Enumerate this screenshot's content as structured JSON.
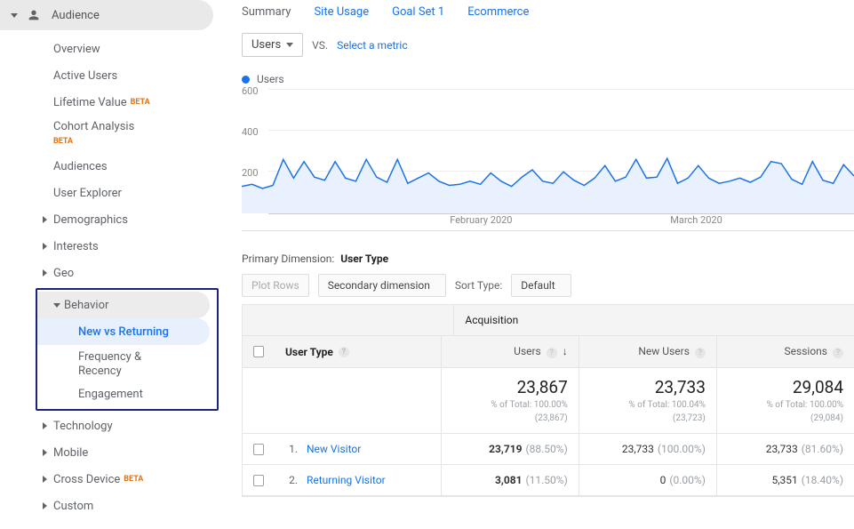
{
  "sidebar": {
    "title": "Audience",
    "items": {
      "overview": "Overview",
      "activeUsers": "Active Users",
      "lifetimeValue": "Lifetime Value",
      "cohortAnalysis": "Cohort Analysis",
      "audiences": "Audiences",
      "userExplorer": "User Explorer",
      "demographics": "Demographics",
      "interests": "Interests",
      "geo": "Geo",
      "behavior": "Behavior",
      "behaviorSub": {
        "newVsReturning": "New vs Returning",
        "frequency": "Frequency & Recency",
        "engagement": "Engagement"
      },
      "technology": "Technology",
      "mobile": "Mobile",
      "crossDevice": "Cross Device",
      "custom": "Custom"
    },
    "beta": "BETA"
  },
  "tabs": {
    "summary": "Summary",
    "siteUsage": "Site Usage",
    "goalSet1": "Goal Set 1",
    "ecommerce": "Ecommerce"
  },
  "metricRow": {
    "primary": "Users",
    "vs": "VS.",
    "selectMetric": "Select a metric"
  },
  "chart": {
    "legend": "Users"
  },
  "chart_data": {
    "type": "area",
    "title": "Users",
    "xlabel": "",
    "ylabel": "",
    "ylim": [
      0,
      600
    ],
    "yticks": [
      200,
      400,
      600
    ],
    "xticks": [
      "February 2020",
      "March 2020"
    ],
    "series": [
      {
        "name": "Users",
        "color": "#1a73e8",
        "values": [
          130,
          140,
          120,
          135,
          260,
          170,
          250,
          175,
          160,
          250,
          170,
          155,
          260,
          175,
          150,
          260,
          145,
          170,
          195,
          155,
          135,
          140,
          155,
          140,
          195,
          155,
          130,
          175,
          210,
          155,
          145,
          200,
          160,
          135,
          170,
          230,
          155,
          175,
          260,
          170,
          175,
          265,
          145,
          170,
          230,
          170,
          145,
          155,
          170,
          150,
          175,
          250,
          240,
          165,
          140,
          250,
          160,
          145,
          235,
          180
        ]
      }
    ]
  },
  "dimension": {
    "label": "Primary Dimension:",
    "value": "User Type",
    "plotRows": "Plot Rows",
    "secondary": "Secondary dimension",
    "sortLabel": "Sort Type:",
    "sortValue": "Default"
  },
  "table": {
    "headers": {
      "userType": "User Type",
      "acquisition": "Acquisition",
      "users": "Users",
      "newUsers": "New Users",
      "sessions": "Sessions"
    },
    "totals": {
      "users": {
        "value": "23,867",
        "note1": "% of Total: 100.00%",
        "note2": "(23,867)"
      },
      "newUsers": {
        "value": "23,733",
        "note1": "% of Total: 100.04%",
        "note2": "(23,723)"
      },
      "sessions": {
        "value": "29,084",
        "note1": "% of Total: 100.00%",
        "note2": "(29,084)"
      }
    },
    "rows": [
      {
        "idx": "1.",
        "label": "New Visitor",
        "users": "23,719",
        "usersPct": "(88.50%)",
        "newUsers": "23,733",
        "newUsersPct": "(100.00%)",
        "sessions": "23,733",
        "sessionsPct": "(81.60%)"
      },
      {
        "idx": "2.",
        "label": "Returning Visitor",
        "users": "3,081",
        "usersPct": "(11.50%)",
        "newUsers": "0",
        "newUsersPct": "(0.00%)",
        "sessions": "5,351",
        "sessionsPct": "(18.40%)"
      }
    ]
  }
}
